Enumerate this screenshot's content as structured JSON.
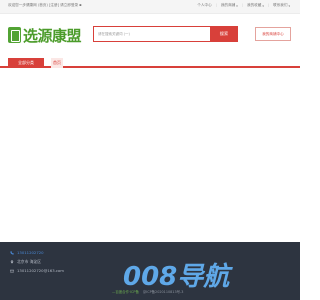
{
  "topbar": {
    "welcome": "欢迎您一步健康网 (首页) [注册] 请立即登录 ▪",
    "links": [
      {
        "label": "个人中心"
      },
      {
        "label": "我的商铺"
      },
      {
        "label": "我的收藏"
      },
      {
        "label": "联系我们"
      }
    ]
  },
  "header": {
    "logo_text": "选源康盟",
    "search_placeholder": "请在搜索关键词 (一)",
    "search_button": "搜索",
    "post_button": "我的商铺中心"
  },
  "nav": {
    "category_button": "全部分类",
    "home": "首页"
  },
  "footer": {
    "phone": "13011202720",
    "address": "北京市 海淀区",
    "email": "13011202720@163.com",
    "bottom_left": "—百度合作·ICP备",
    "bottom_right": "京ICP备2020110813号-3",
    "watermark": "008导航"
  },
  "colors": {
    "accent": "#d8403a",
    "logo_green": "#4c9c2b",
    "footer_bg": "#2d3440",
    "watermark": "#5fa8e8"
  }
}
